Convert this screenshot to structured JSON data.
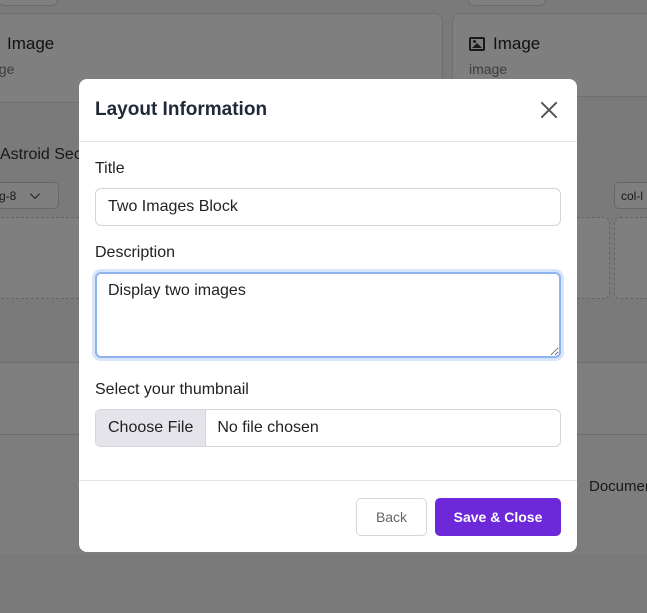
{
  "background": {
    "card_left": {
      "title": "Image",
      "subtitle": "age"
    },
    "card_right": {
      "title": "Image",
      "subtitle": "image"
    },
    "section_title": "Astroid Sec",
    "select_left": "g-8",
    "select_right": "col-l",
    "doc_text": "Documen"
  },
  "modal": {
    "title": "Layout Information",
    "title_field": {
      "label": "Title",
      "value": "Two Images Block"
    },
    "description_field": {
      "label": "Description",
      "value": "Display two images"
    },
    "thumbnail_field": {
      "label": "Select your thumbnail",
      "button_label": "Choose File",
      "status": "No file chosen"
    },
    "footer": {
      "back_label": "Back",
      "save_label": "Save & Close"
    }
  },
  "colors": {
    "accent": "#6d28d9",
    "focus_ring": "#8fb2f0",
    "overlay": "rgba(0,0,0,0.5)"
  }
}
